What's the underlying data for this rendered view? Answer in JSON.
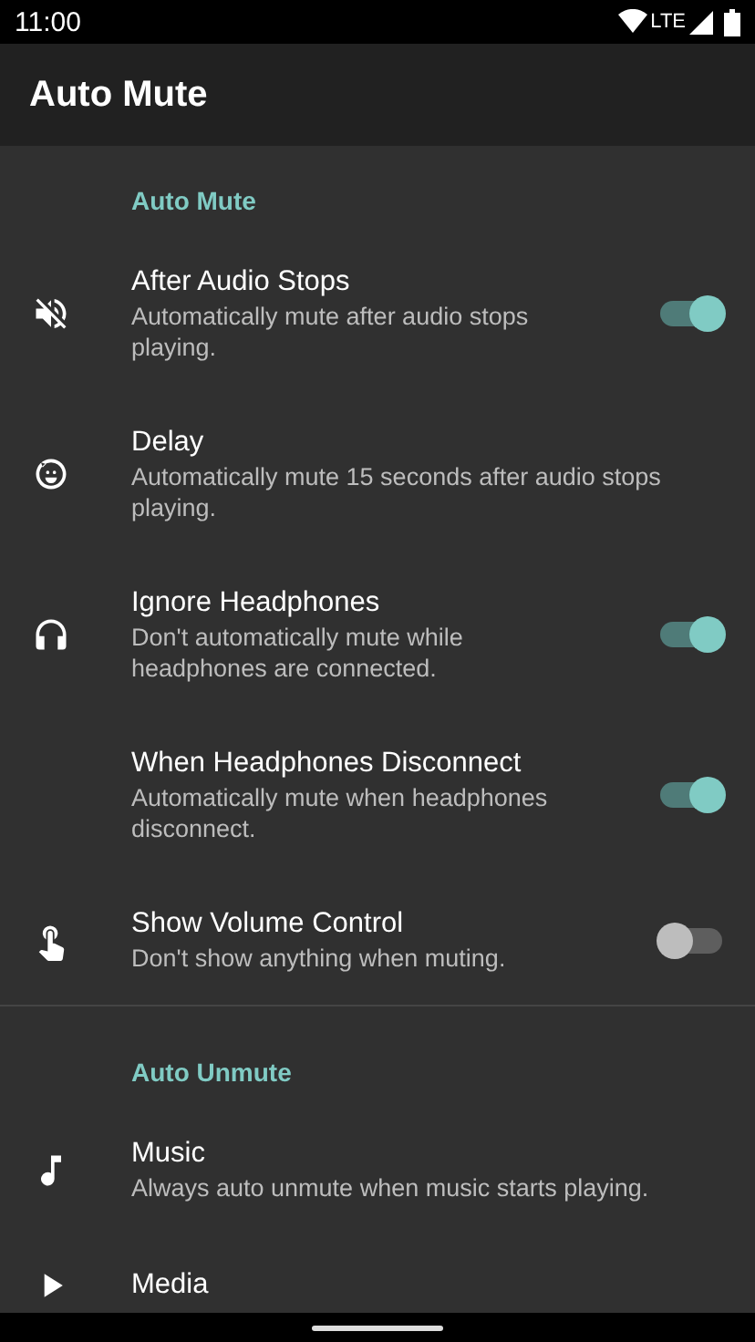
{
  "status_bar": {
    "time": "11:00",
    "network": "LTE"
  },
  "app_bar": {
    "title": "Auto Mute"
  },
  "sections": [
    {
      "header": "Auto Mute",
      "items": [
        {
          "kind": "switch",
          "title": "After Audio Stops",
          "summary": "Automatically mute after audio stops playing.",
          "on": true
        },
        {
          "kind": "plain",
          "title": "Delay",
          "summary": "Automatically mute 15 seconds after audio stops playing."
        },
        {
          "kind": "switch",
          "title": "Ignore Headphones",
          "summary": "Don't automatically mute while headphones are connected.",
          "on": true
        },
        {
          "kind": "switch",
          "title": "When Headphones Disconnect",
          "summary": "Automatically mute when headphones disconnect.",
          "on": true
        },
        {
          "kind": "switch",
          "title": "Show Volume Control",
          "summary": "Don't show anything when muting.",
          "on": false
        }
      ]
    },
    {
      "header": "Auto Unmute",
      "items": [
        {
          "kind": "plain",
          "title": "Music",
          "summary": "Always auto unmute when music starts playing."
        },
        {
          "kind": "plain",
          "title": "Media"
        }
      ]
    }
  ]
}
